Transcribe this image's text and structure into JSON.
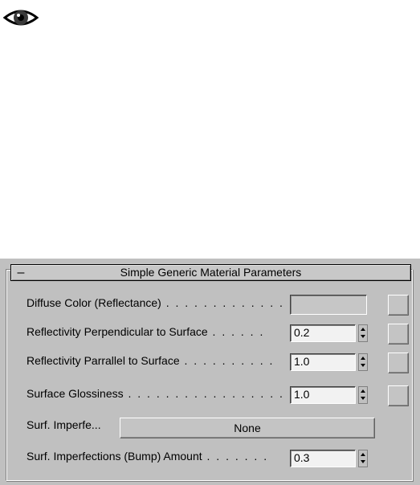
{
  "icons": {
    "eye": "eye-icon",
    "spinner": "spinner-arrows-icon"
  },
  "colors": {
    "panel_bg": "#c0c0c0",
    "field_bg": "#f2f2f2",
    "swatch": "#c6c6c6"
  },
  "rollout": {
    "collapse_symbol": "–",
    "title": "Simple Generic Material Parameters"
  },
  "params": {
    "diffuse_label": "Diffuse Color (Reflectance)",
    "diffuse_dots": " . . . . . . . . . . . . .",
    "refl_perp_label": "Reflectivity Perpendicular to Surface",
    "refl_perp_dots": " . . . . . .",
    "refl_perp_value": "0.2",
    "refl_par_label": "Reflectivity Parrallel to Surface",
    "refl_par_dots": " . . . . . . . . . .",
    "refl_par_value": "1.0",
    "gloss_label": "Surface Glossiness",
    "gloss_dots": " . . . . . . . . . . . . . . . . . . .",
    "gloss_value": "1.0",
    "imperf_label": "Surf. Imperfe...",
    "imperf_map": "None",
    "bump_label": "Surf. Imperfections (Bump) Amount",
    "bump_dots": " . . . . . . .",
    "bump_value": "0.3"
  }
}
